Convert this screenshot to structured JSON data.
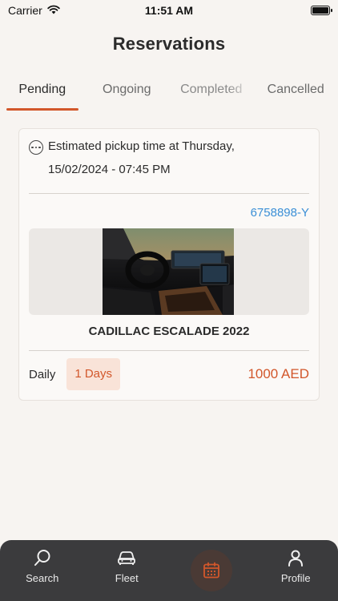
{
  "status_bar": {
    "carrier": "Carrier",
    "time": "11:51 AM"
  },
  "header": {
    "title": "Reservations"
  },
  "tabs": [
    {
      "label": "Pending",
      "active": true
    },
    {
      "label": "Ongoing",
      "active": false
    },
    {
      "label": "Completed",
      "active": false
    },
    {
      "label": "Cancelled",
      "active": false
    }
  ],
  "reservation": {
    "pickup_line1": "Estimated pickup time at Thursday,",
    "pickup_line2": "15/02/2024 - 07:45 PM",
    "reference": "6758898-Y",
    "car_name": "CADILLAC ESCALADE 2022",
    "rate_type": "Daily",
    "duration": "1 Days",
    "price": "1000 AED"
  },
  "bottom_nav": {
    "search": "Search",
    "fleet": "Fleet",
    "profile": "Profile"
  },
  "colors": {
    "accent": "#d2572b",
    "link": "#3b8fd6",
    "nav_bg": "#3b3b3d",
    "background": "#f7f4f1"
  }
}
